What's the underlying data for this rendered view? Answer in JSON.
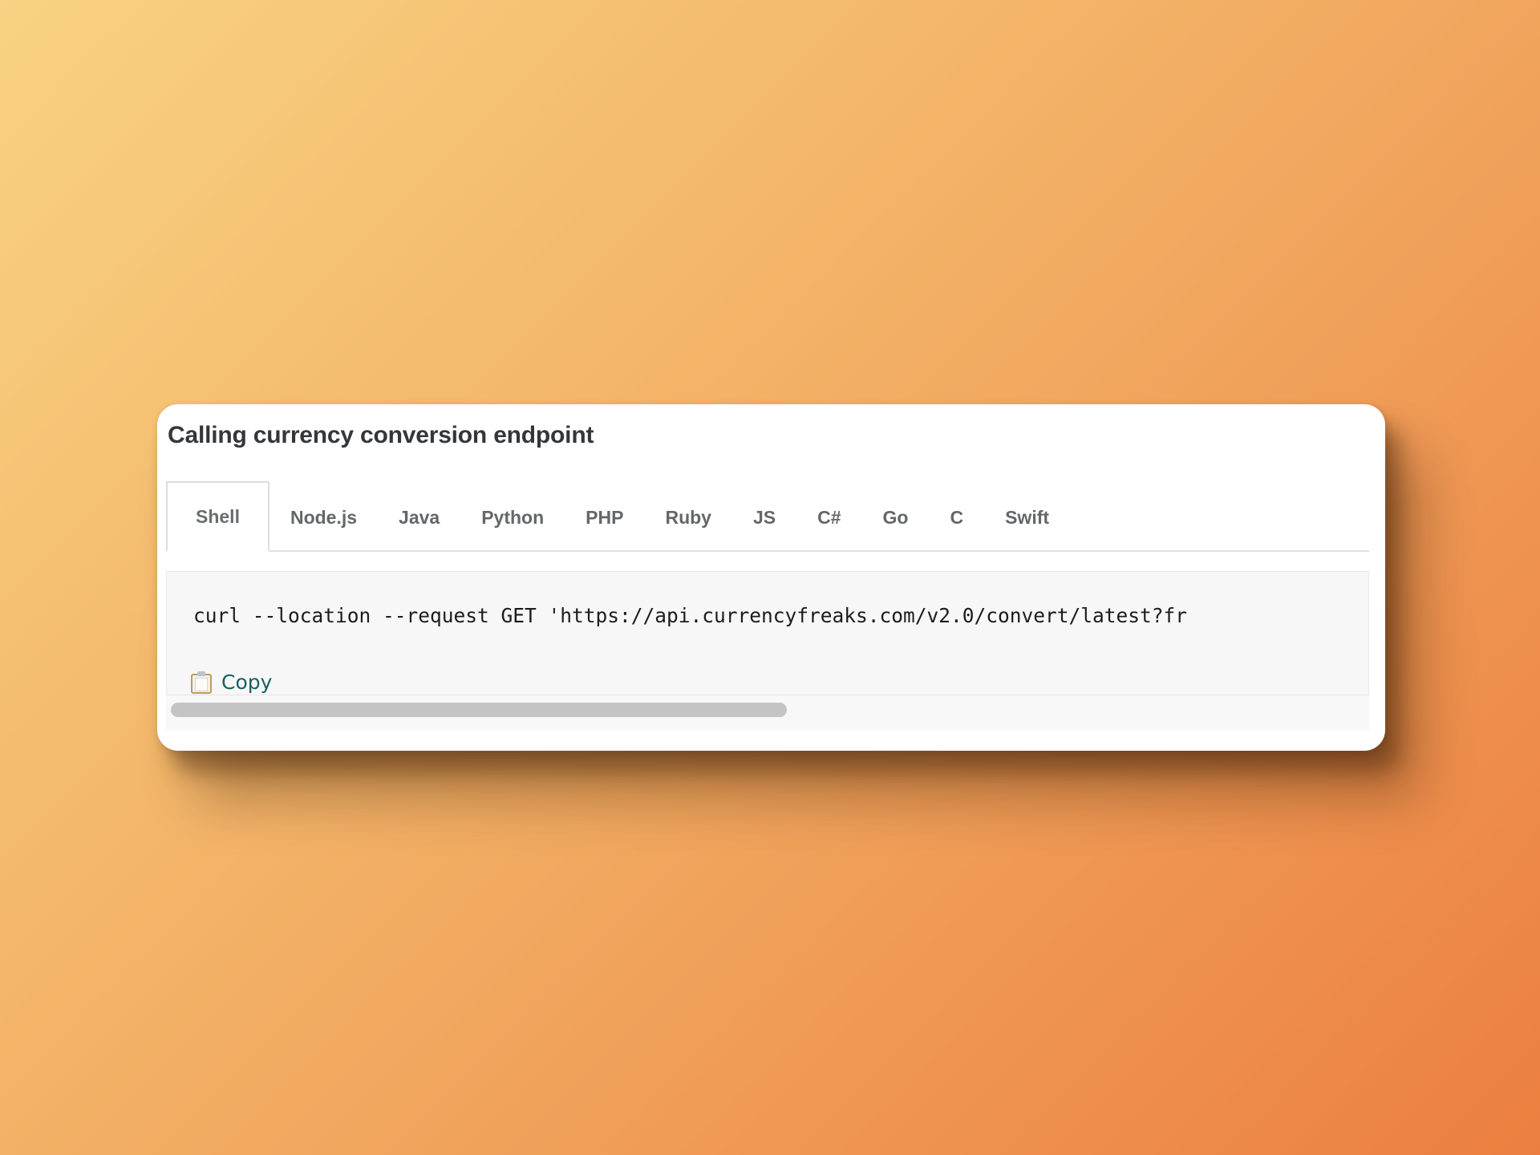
{
  "background": {
    "gradient_start": "#f8d382",
    "gradient_end": "#ec7f3f"
  },
  "card": {
    "title": "Calling currency conversion endpoint",
    "background_color": "#ffffff",
    "title_color": "#33373b"
  },
  "tabs": {
    "active_index": 0,
    "active_tab_label": "Shell",
    "items": [
      {
        "label": "Shell",
        "active": true
      },
      {
        "label": "Node.js",
        "active": false
      },
      {
        "label": "Java",
        "active": false
      },
      {
        "label": "Python",
        "active": false
      },
      {
        "label": "PHP",
        "active": false
      },
      {
        "label": "Ruby",
        "active": false
      },
      {
        "label": "JS",
        "active": false
      },
      {
        "label": "C#",
        "active": false
      },
      {
        "label": "Go",
        "active": false
      },
      {
        "label": "C",
        "active": false
      },
      {
        "label": "Swift",
        "active": false
      }
    ]
  },
  "code_block": {
    "language": "shell",
    "background_color": "#f7f7f7",
    "text_color": "#1c1c1c",
    "content_visible": "curl --location --request GET 'https://api.currencyfreaks.com/v2.0/convert/latest?fr",
    "truncated": true
  },
  "copy": {
    "label": "Copy",
    "icon": "clipboard-icon",
    "link_color": "#17625f"
  },
  "scrollbar": {
    "orientation": "horizontal",
    "thumb_color": "#c4c4c4",
    "track_color": "#f8f8f8",
    "thumb_fraction_percent": 52
  }
}
